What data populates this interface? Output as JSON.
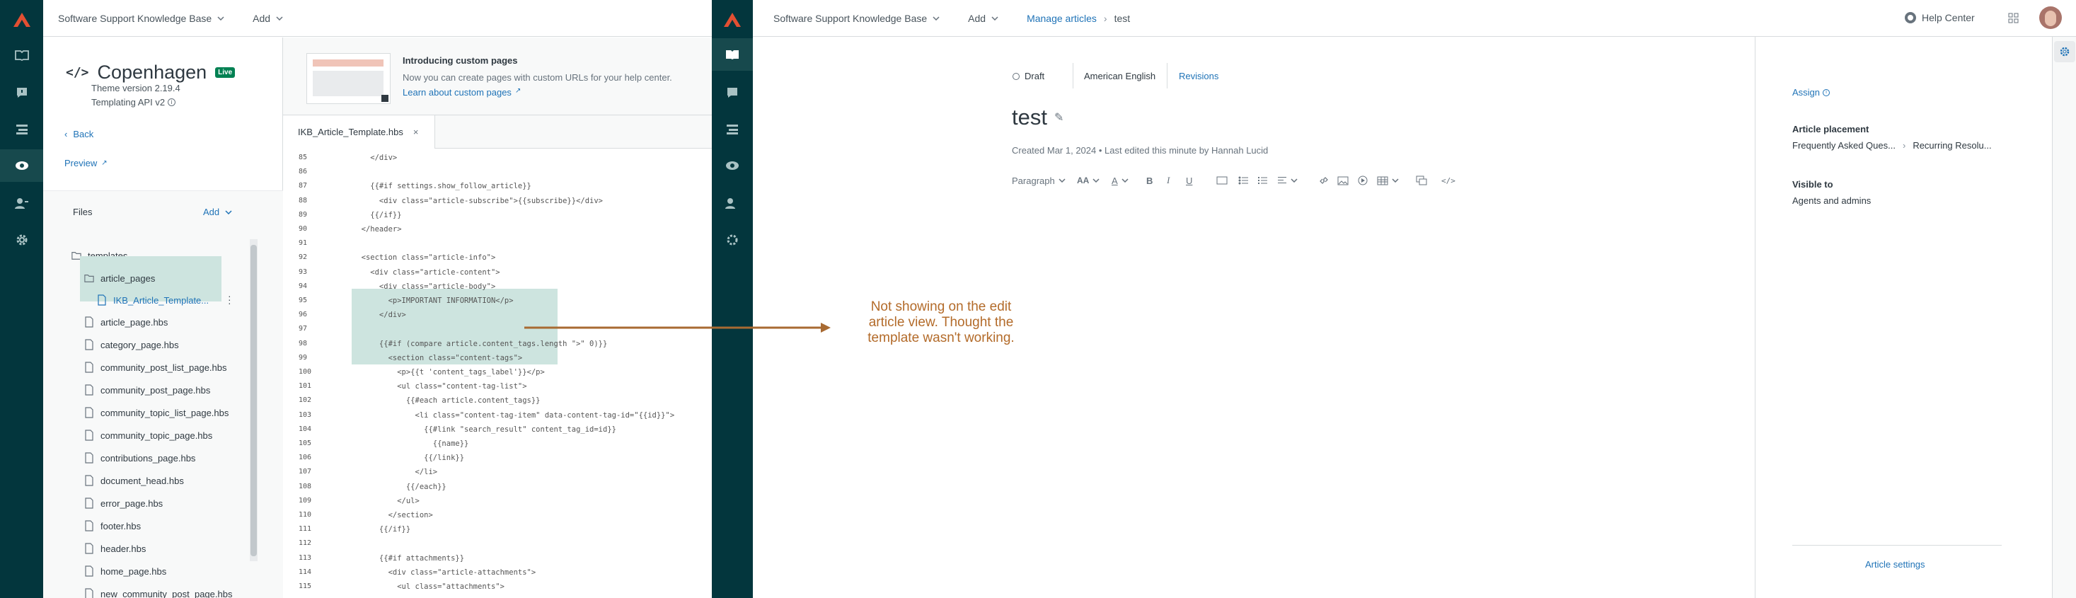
{
  "left_window": {
    "topbar": {
      "kb_name": "Software Support Knowledge Base",
      "add_label": "Add"
    },
    "theme": {
      "name": "Copenhagen",
      "live_badge": "Live",
      "version": "Theme version 2.19.4",
      "api": "Templating API v2",
      "back_label": "Back",
      "preview_label": "Preview"
    },
    "files": {
      "heading": "Files",
      "add_label": "Add",
      "folder": "templates",
      "subfolder": "article_pages",
      "selected_file": "IKB_Article_Template...",
      "list": [
        "article_page.hbs",
        "category_page.hbs",
        "community_post_list_page.hbs",
        "community_post_page.hbs",
        "community_topic_list_page.hbs",
        "community_topic_page.hbs",
        "contributions_page.hbs",
        "document_head.hbs",
        "error_page.hbs",
        "footer.hbs",
        "header.hbs",
        "home_page.hbs",
        "new_community_post_page.hbs"
      ]
    },
    "banner": {
      "title": "Introducing custom pages",
      "body": "Now you can create pages with custom URLs for your help center.",
      "link": "Learn about custom pages"
    },
    "editor_tab": "IKB_Article_Template.hbs",
    "code_lines": [
      {
        "n": "85",
        "t": "    </div>"
      },
      {
        "n": "86",
        "t": ""
      },
      {
        "n": "87",
        "t": "    {{#if settings.show_follow_article}}"
      },
      {
        "n": "88",
        "t": "      <div class=\"article-subscribe\">{{subscribe}}</div>"
      },
      {
        "n": "89",
        "t": "    {{/if}}"
      },
      {
        "n": "90",
        "t": "  </header>"
      },
      {
        "n": "91",
        "t": ""
      },
      {
        "n": "92",
        "t": "  <section class=\"article-info\">"
      },
      {
        "n": "93",
        "t": "    <div class=\"article-content\">"
      },
      {
        "n": "94",
        "t": "      <div class=\"article-body\">"
      },
      {
        "n": "95",
        "t": "        <p>IMPORTANT INFORMATION</p>"
      },
      {
        "n": "96",
        "t": "      </div>"
      },
      {
        "n": "97",
        "t": ""
      },
      {
        "n": "98",
        "t": "      {{#if (compare article.content_tags.length \">\" 0)}}"
      },
      {
        "n": "99",
        "t": "        <section class=\"content-tags\">"
      },
      {
        "n": "100",
        "t": "          <p>{{t 'content_tags_label'}}</p>"
      },
      {
        "n": "101",
        "t": "          <ul class=\"content-tag-list\">"
      },
      {
        "n": "102",
        "t": "            {{#each article.content_tags}}"
      },
      {
        "n": "103",
        "t": "              <li class=\"content-tag-item\" data-content-tag-id=\"{{id}}\">"
      },
      {
        "n": "104",
        "t": "                {{#link \"search_result\" content_tag_id=id}}"
      },
      {
        "n": "105",
        "t": "                  {{name}}"
      },
      {
        "n": "106",
        "t": "                {{/link}}"
      },
      {
        "n": "107",
        "t": "              </li>"
      },
      {
        "n": "108",
        "t": "            {{/each}}"
      },
      {
        "n": "109",
        "t": "          </ul>"
      },
      {
        "n": "110",
        "t": "        </section>"
      },
      {
        "n": "111",
        "t": "      {{/if}}"
      },
      {
        "n": "112",
        "t": ""
      },
      {
        "n": "113",
        "t": "      {{#if attachments}}"
      },
      {
        "n": "114",
        "t": "        <div class=\"article-attachments\">"
      },
      {
        "n": "115",
        "t": "          <ul class=\"attachments\">"
      }
    ]
  },
  "right_window": {
    "topbar": {
      "kb_name": "Software Support Knowledge Base",
      "add_label": "Add",
      "breadcrumb_parent": "Manage articles",
      "breadcrumb_current": "test",
      "help_label": "Help Center"
    },
    "article": {
      "status": "Draft",
      "locale": "American English",
      "revisions": "Revisions",
      "title": "test",
      "meta": "Created Mar 1, 2024 • Last edited this minute by Hannah Lucid",
      "paragraph_label": "Paragraph"
    },
    "panel": {
      "assign": "Assign",
      "placement_label": "Article placement",
      "placement_path_1": "Frequently Asked Ques...",
      "placement_path_2": "Recurring Resolu...",
      "visible_label": "Visible to",
      "visible_value": "Agents and admins",
      "settings_link": "Article settings"
    }
  },
  "annotation": {
    "text": "Not showing on the edit article view. Thought the template wasn't working.",
    "color": "#b36b2a"
  },
  "colors": {
    "rail": "#03363d",
    "link": "#1f73b7",
    "highlight": "#cde4df",
    "live": "#038153"
  }
}
